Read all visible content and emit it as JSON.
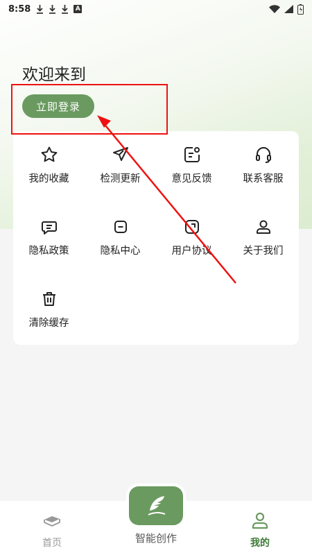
{
  "status_bar": {
    "time": "8:58",
    "notif_letter": "A"
  },
  "header": {
    "welcome": "欢迎来到",
    "login_button": "立即登录"
  },
  "menu": {
    "items": [
      {
        "label": "我的收藏",
        "icon": "star-icon"
      },
      {
        "label": "检测更新",
        "icon": "send-icon"
      },
      {
        "label": "意见反馈",
        "icon": "feedback-icon"
      },
      {
        "label": "联系客服",
        "icon": "headset-icon"
      },
      {
        "label": "隐私政策",
        "icon": "chat-icon"
      },
      {
        "label": "隐私中心",
        "icon": "privacy-icon"
      },
      {
        "label": "用户协议",
        "icon": "agreement-icon"
      },
      {
        "label": "关于我们",
        "icon": "person-icon"
      },
      {
        "label": "清除缓存",
        "icon": "trash-icon"
      }
    ]
  },
  "tabbar": {
    "home": "首页",
    "create": "智能创作",
    "mine": "我的"
  },
  "colors": {
    "accent": "#6a9a60",
    "annotation": "#e11111"
  }
}
